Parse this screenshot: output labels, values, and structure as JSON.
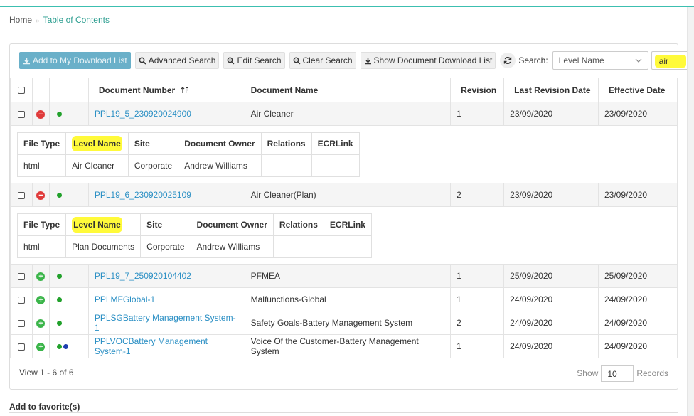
{
  "breadcrumb": {
    "home": "Home",
    "separator": "»",
    "current": "Table of Contents"
  },
  "toolbar": {
    "add_download": "Add to My Download List",
    "advanced_search": "Advanced Search",
    "edit_search": "Edit Search",
    "clear_search": "Clear Search",
    "show_download_list": "Show Document Download List",
    "search_label": "Search:",
    "search_field": "Level Name",
    "search_value": "air"
  },
  "columns": [
    "Document Number",
    "Document Name",
    "Revision",
    "Last Revision Date",
    "Effective Date"
  ],
  "sub_columns_1": [
    "File Type",
    "Level Name",
    "Site",
    "Document Owner",
    "Relations",
    "ECRLink"
  ],
  "sub_columns_2": [
    "File Type",
    "Level Name",
    "Site",
    "Document Owner",
    "Relations",
    "ECRLink"
  ],
  "rows": [
    {
      "number": "PPL19_5_230920024900",
      "name": "Air Cleaner",
      "revision": "1",
      "last_revision": "23/09/2020",
      "effective": "23/09/2020",
      "detail": {
        "file_type": "html",
        "level_name": "Air Cleaner",
        "site": "Corporate",
        "owner": "Andrew Williams",
        "relations": "",
        "ecrlink": ""
      }
    },
    {
      "number": "PPL19_6_230920025109",
      "name": "Air Cleaner(Plan)",
      "revision": "2",
      "last_revision": "23/09/2020",
      "effective": "23/09/2020",
      "detail": {
        "file_type": "html",
        "level_name": "Plan Documents",
        "site": "Corporate",
        "owner": "Andrew Williams",
        "relations": "",
        "ecrlink": ""
      }
    },
    {
      "number": "PPL19_7_250920104402",
      "name": "PFMEA",
      "revision": "1",
      "last_revision": "25/09/2020",
      "effective": "25/09/2020"
    },
    {
      "number": "PPLMFGlobal-1",
      "name": "Malfunctions-Global",
      "revision": "1",
      "last_revision": "24/09/2020",
      "effective": "24/09/2020"
    },
    {
      "number": "PPLSGBattery Management System-1",
      "name": "Safety Goals-Battery Management System",
      "revision": "2",
      "last_revision": "24/09/2020",
      "effective": "24/09/2020"
    },
    {
      "number": "PPLVOCBattery Management System-1",
      "name": "Voice Of the Customer-Battery Management System",
      "revision": "1",
      "last_revision": "24/09/2020",
      "effective": "24/09/2020"
    }
  ],
  "pager": {
    "view_text": "View 1 - 6 of 6",
    "show_label": "Show",
    "page_size": "10",
    "records_label": "Records"
  },
  "favorites_label": "Add to favorite(s)",
  "colors": {
    "accent": "#3cbfb0",
    "link": "#2a8fc4",
    "highlight": "#fffa3a",
    "expand": "#3bb54a",
    "collapse": "#e03b3b"
  }
}
